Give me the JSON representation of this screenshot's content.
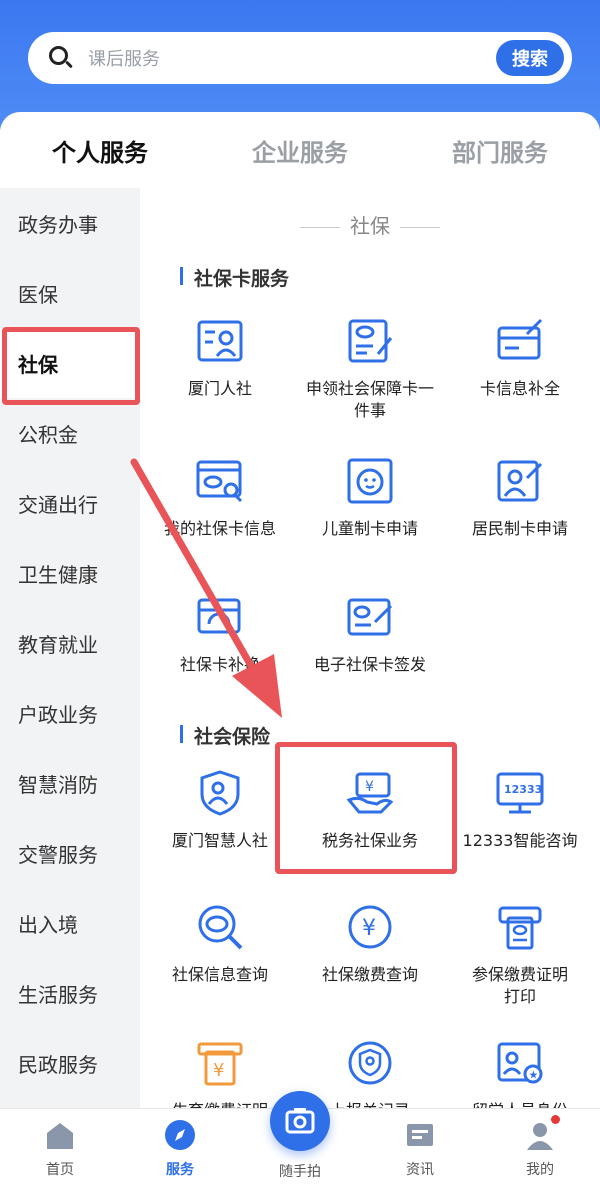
{
  "search": {
    "placeholder": "课后服务",
    "button": "搜索"
  },
  "tabs": [
    "个人服务",
    "企业服务",
    "部门服务"
  ],
  "sidebar": [
    "政务办事",
    "医保",
    "社保",
    "公积金",
    "交通出行",
    "卫生健康",
    "教育就业",
    "户政业务",
    "智慧消防",
    "交警服务",
    "出入境",
    "生活服务",
    "民政服务"
  ],
  "section": "社保",
  "groups": [
    {
      "title": "社保卡服务",
      "items": [
        {
          "label": "厦门人社",
          "icon": "id-card-person-icon"
        },
        {
          "label": "申领社会保障卡一件事",
          "icon": "card-edit-icon"
        },
        {
          "label": "卡信息补全",
          "icon": "card-pen-icon"
        },
        {
          "label": "我的社保卡信息",
          "icon": "card-search-icon"
        },
        {
          "label": "儿童制卡申请",
          "icon": "child-face-icon"
        },
        {
          "label": "居民制卡申请",
          "icon": "person-card-icon"
        },
        {
          "label": "社保卡补换",
          "icon": "card-refresh-icon"
        },
        {
          "label": "电子社保卡签发",
          "icon": "card-sign-icon"
        }
      ]
    },
    {
      "title": "社会保险",
      "items": [
        {
          "label": "厦门智慧人社",
          "icon": "shield-person-icon"
        },
        {
          "label": "税务社保业务",
          "icon": "hand-money-icon"
        },
        {
          "label": "12333智能咨询",
          "icon": "monitor-12333-icon"
        },
        {
          "label": "社保信息查询",
          "icon": "search-si-icon"
        },
        {
          "label": "社保缴费查询",
          "icon": "yuan-circle-icon"
        },
        {
          "label": "参保缴费证明打印",
          "icon": "printer-icon"
        },
        {
          "label": "生育缴费证明",
          "icon": "receipt-yuan-icon"
        },
        {
          "label": "上报关记录",
          "icon": "shield-badge-icon"
        },
        {
          "label": "留学人员身份",
          "icon": "id-star-icon"
        }
      ]
    }
  ],
  "bottom_nav": [
    {
      "label": "首页",
      "icon": "home-icon"
    },
    {
      "label": "服务",
      "icon": "compass-icon"
    },
    {
      "label": "随手拍",
      "icon": "camera-icon"
    },
    {
      "label": "资讯",
      "icon": "news-icon"
    },
    {
      "label": "我的",
      "icon": "user-icon"
    }
  ],
  "colors": {
    "accent": "#2f6fe8",
    "highlight": "#e85457"
  }
}
